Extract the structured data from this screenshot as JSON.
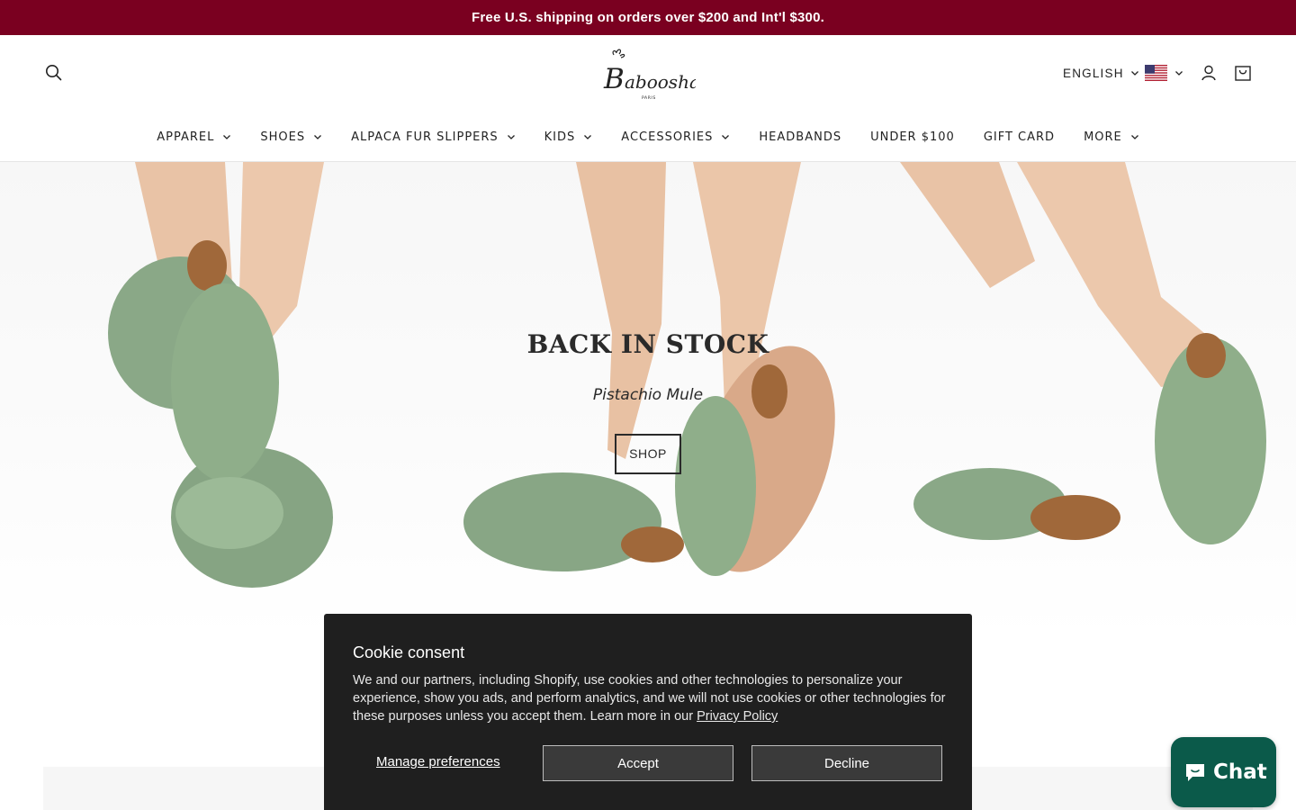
{
  "announcement": {
    "text": "Free U.S. shipping on orders over $200 and Int'l $300."
  },
  "header": {
    "logo_text": "Baboosha",
    "logo_subtext": "PARIS",
    "language": "ENGLISH",
    "country_flag": "us-flag",
    "icons": [
      "search-icon",
      "chevron-down-icon",
      "account-icon",
      "cart-icon"
    ]
  },
  "nav": {
    "items": [
      {
        "label": "APPAREL",
        "has_dropdown": true
      },
      {
        "label": "SHOES",
        "has_dropdown": true
      },
      {
        "label": "ALPACA FUR SLIPPERS",
        "has_dropdown": true
      },
      {
        "label": "KIDS",
        "has_dropdown": true
      },
      {
        "label": "ACCESSORIES",
        "has_dropdown": true
      },
      {
        "label": "HEADBANDS",
        "has_dropdown": false
      },
      {
        "label": "UNDER $100",
        "has_dropdown": false
      },
      {
        "label": "GIFT CARD",
        "has_dropdown": false
      },
      {
        "label": "MORE",
        "has_dropdown": true
      }
    ]
  },
  "hero": {
    "title": "BACK IN STOCK",
    "subtitle": "Pistachio Mule",
    "button_label": "SHOP"
  },
  "cookie": {
    "title": "Cookie consent",
    "body": "We and our partners, including Shopify, use cookies and other technologies to personalize your experience, show you ads, and perform analytics, and we will not use cookies or other technologies for these purposes unless you accept them. Learn more in our",
    "link": "Privacy Policy",
    "manage_label": "Manage preferences",
    "accept_label": "Accept",
    "decline_label": "Decline"
  },
  "chat": {
    "label": "Chat"
  },
  "colors": {
    "announcement_bg": "#7a0020",
    "chat_bg": "#0b5a4a",
    "cookie_bg": "#1f1f1f",
    "slipper_green": "#8fae8a"
  }
}
